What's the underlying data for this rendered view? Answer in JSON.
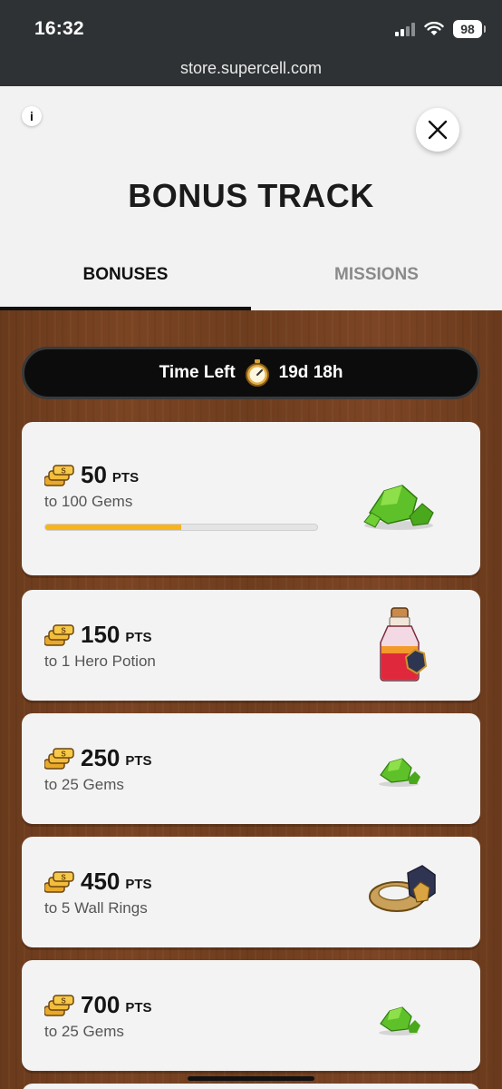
{
  "status": {
    "time": "16:32",
    "battery": "98"
  },
  "browser": {
    "url": "store.supercell.com"
  },
  "header": {
    "info_label": "i",
    "title": "BONUS TRACK",
    "tabs": [
      {
        "label": "BONUSES",
        "active": true
      },
      {
        "label": "MISSIONS",
        "active": false
      }
    ]
  },
  "timer": {
    "label": "Time Left",
    "value": "19d 18h"
  },
  "rewards": [
    {
      "points": "50",
      "unit": "PTS",
      "reward": "to 100 Gems",
      "progress": 0.5,
      "icon": "gem-pile-icon"
    },
    {
      "points": "150",
      "unit": "PTS",
      "reward": "to 1 Hero Potion",
      "icon": "hero-potion-icon"
    },
    {
      "points": "250",
      "unit": "PTS",
      "reward": "to 25 Gems",
      "icon": "gem-icon"
    },
    {
      "points": "450",
      "unit": "PTS",
      "reward": "to 5 Wall Rings",
      "icon": "wall-ring-icon"
    },
    {
      "points": "700",
      "unit": "PTS",
      "reward": "to 25 Gems",
      "icon": "gem-icon"
    }
  ],
  "colors": {
    "progress": "#f8b41a",
    "gem": "#5fc12a",
    "wood": "#6e3d1e"
  }
}
